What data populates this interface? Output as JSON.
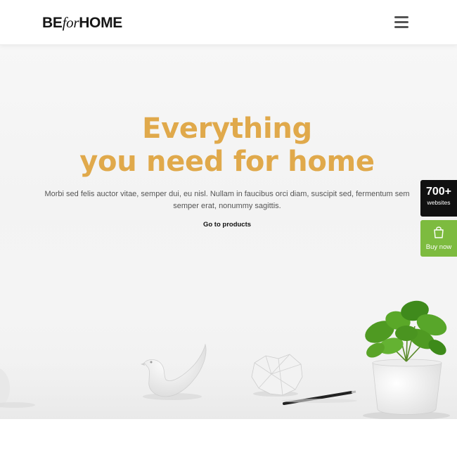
{
  "header": {
    "logo": {
      "be": "BE",
      "for": "for",
      "home": "HOME"
    },
    "menu_icon": "hamburger-menu-icon"
  },
  "hero": {
    "title_line1": "Everything",
    "title_line2": "you need for home",
    "description": "Morbi sed felis auctor vitae, semper dui, eu nisl. Nullam in faucibus orci diam, suscipit sed, fermentum sem semper erat, nonummy sagittis.",
    "cta": "Go to products"
  },
  "side_badges": {
    "websites": {
      "count": "700+",
      "label": "websites"
    },
    "buy": {
      "icon": "shopping-bag-icon",
      "label": "Buy now"
    }
  },
  "colors": {
    "accent": "#e0a94b",
    "buy_green": "#7dbb3f",
    "dark": "#111111"
  }
}
